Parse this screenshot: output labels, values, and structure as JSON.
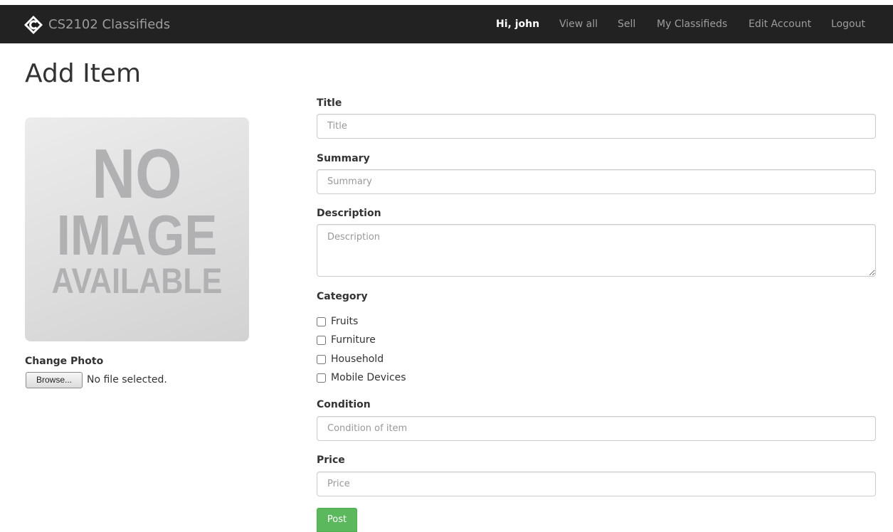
{
  "navbar": {
    "brand": "CS2102 Classifieds",
    "greeting": "Hi, john",
    "links": [
      "View all",
      "Sell",
      "My Classifieds",
      "Edit Account",
      "Logout"
    ]
  },
  "page_title": "Add Item",
  "photo": {
    "placeholder_lines": [
      "NO",
      "IMAGE",
      "AVAILABLE"
    ],
    "change_label": "Change Photo",
    "browse_label": "Browse...",
    "file_status": "No file selected."
  },
  "form": {
    "title": {
      "label": "Title",
      "placeholder": "Title",
      "value": ""
    },
    "summary": {
      "label": "Summary",
      "placeholder": "Summary",
      "value": ""
    },
    "description": {
      "label": "Description",
      "placeholder": "Description",
      "value": ""
    },
    "category": {
      "label": "Category",
      "options": [
        {
          "label": "Fruits",
          "checked": false
        },
        {
          "label": "Furniture",
          "checked": false
        },
        {
          "label": "Household",
          "checked": false
        },
        {
          "label": "Mobile Devices",
          "checked": false
        }
      ]
    },
    "condition": {
      "label": "Condition",
      "placeholder": "Condition of item",
      "value": ""
    },
    "price": {
      "label": "Price",
      "placeholder": "Price",
      "value": ""
    },
    "submit_label": "Post"
  },
  "colors": {
    "navbar_bg": "#222222",
    "nav_text": "#9d9d9d",
    "post_button": "#5cb85c"
  },
  "icons": {
    "brand_logo": "cs2102-logo-icon"
  }
}
